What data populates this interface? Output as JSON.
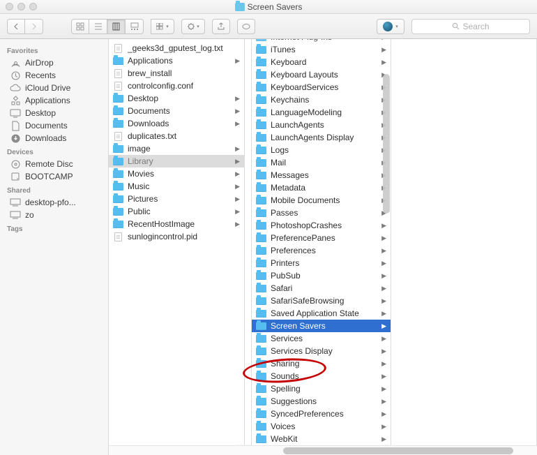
{
  "window": {
    "title": "Screen Savers"
  },
  "search": {
    "placeholder": "Search"
  },
  "sidebar": {
    "favorites_header": "Favorites",
    "favorites": [
      {
        "icon": "airdrop",
        "label": "AirDrop"
      },
      {
        "icon": "recents",
        "label": "Recents"
      },
      {
        "icon": "icloud",
        "label": "iCloud Drive"
      },
      {
        "icon": "apps",
        "label": "Applications"
      },
      {
        "icon": "desktop",
        "label": "Desktop"
      },
      {
        "icon": "documents",
        "label": "Documents"
      },
      {
        "icon": "downloads",
        "label": "Downloads"
      }
    ],
    "devices_header": "Devices",
    "devices": [
      {
        "icon": "disc",
        "label": "Remote Disc"
      },
      {
        "icon": "disk",
        "label": "BOOTCAMP"
      }
    ],
    "shared_header": "Shared",
    "shared": [
      {
        "icon": "computer",
        "label": "desktop-pfo..."
      },
      {
        "icon": "computer",
        "label": "zo"
      }
    ],
    "tags_header": "Tags"
  },
  "col1": {
    "items": [
      {
        "type": "file",
        "label": "_geeks3d_gputest_log.txt"
      },
      {
        "type": "folder",
        "label": "Applications",
        "has_children": true
      },
      {
        "type": "file",
        "label": "brew_install"
      },
      {
        "type": "file",
        "label": "controlconfig.conf"
      },
      {
        "type": "folder",
        "label": "Desktop",
        "has_children": true
      },
      {
        "type": "folder",
        "label": "Documents",
        "has_children": true
      },
      {
        "type": "folder",
        "label": "Downloads",
        "has_children": true
      },
      {
        "type": "file",
        "label": "duplicates.txt"
      },
      {
        "type": "folder",
        "label": "image",
        "has_children": true
      },
      {
        "type": "folder",
        "label": "Library",
        "has_children": true,
        "selected": "inactive"
      },
      {
        "type": "folder",
        "label": "Movies",
        "has_children": true
      },
      {
        "type": "folder",
        "label": "Music",
        "has_children": true
      },
      {
        "type": "folder",
        "label": "Pictures",
        "has_children": true
      },
      {
        "type": "folder",
        "label": "Public",
        "has_children": true
      },
      {
        "type": "folder",
        "label": "RecentHostImage",
        "has_children": true
      },
      {
        "type": "file",
        "label": "sunlogincontrol.pid"
      }
    ]
  },
  "col3": {
    "items": [
      {
        "label": "Internet Plug-Ins",
        "truncated_top": true
      },
      {
        "label": "iTunes"
      },
      {
        "label": "Keyboard"
      },
      {
        "label": "Keyboard Layouts"
      },
      {
        "label": "KeyboardServices"
      },
      {
        "label": "Keychains"
      },
      {
        "label": "LanguageModeling"
      },
      {
        "label": "LaunchAgents"
      },
      {
        "label": "LaunchAgents Display"
      },
      {
        "label": "Logs"
      },
      {
        "label": "Mail"
      },
      {
        "label": "Messages"
      },
      {
        "label": "Metadata"
      },
      {
        "label": "Mobile Documents"
      },
      {
        "label": "Passes"
      },
      {
        "label": "PhotoshopCrashes"
      },
      {
        "label": "PreferencePanes"
      },
      {
        "label": "Preferences"
      },
      {
        "label": "Printers"
      },
      {
        "label": "PubSub"
      },
      {
        "label": "Safari"
      },
      {
        "label": "SafariSafeBrowsing"
      },
      {
        "label": "Saved Application State"
      },
      {
        "label": "Screen Savers",
        "selected": "active"
      },
      {
        "label": "Services"
      },
      {
        "label": "Services Display"
      },
      {
        "label": "Sharing"
      },
      {
        "label": "Sounds"
      },
      {
        "label": "Spelling"
      },
      {
        "label": "Suggestions"
      },
      {
        "label": "SyncedPreferences"
      },
      {
        "label": "Voices"
      },
      {
        "label": "WebKit"
      }
    ]
  }
}
